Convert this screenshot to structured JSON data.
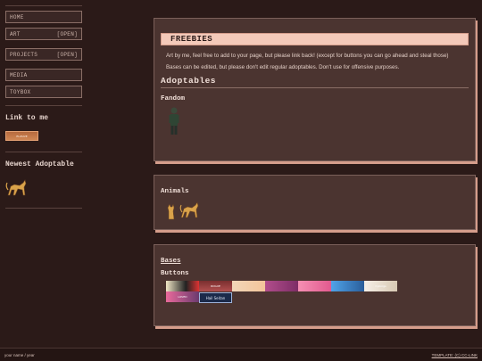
{
  "nav": {
    "items": [
      {
        "label": "HOME",
        "status": ""
      },
      {
        "label": "ART",
        "status": "[OPEN]"
      },
      {
        "label": "PROJECTS",
        "status": "[OPEN]"
      },
      {
        "label": "MEDIA",
        "status": ""
      },
      {
        "label": "TOYBOX",
        "status": ""
      }
    ]
  },
  "sidebar": {
    "link_heading": "Link to me",
    "link_button_text": "ELUSIVE",
    "newest_heading": "Newest Adoptable"
  },
  "freebies": {
    "title": "FREEBIES",
    "para1": "Art by me, feel free to add to your page, but please link back! (except for buttons you can go ahead and steal those)",
    "para2": "Bases can be edited, but please don't edit regular adoptables. Don't use for offensive purposes.",
    "adoptables_heading": "Adoptables",
    "fandom_heading": "Fandom"
  },
  "animals": {
    "heading": "Animals"
  },
  "bases": {
    "heading": "Bases",
    "buttons_heading": "Buttons",
    "hail_button_text": "Hail Seitan",
    "button_texts": [
      "",
      "ROGUE",
      "",
      "",
      "",
      "",
      "",
      "",
      "Cyborgs",
      "I'M",
      "",
      "LOVED"
    ]
  },
  "footer": {
    "left": "your name / year",
    "right": "TEMPLATE: (C) CC-LINK"
  },
  "colors": {
    "background": "#2b1a18",
    "panel": "#4b3430",
    "accent": "#f3c9b9",
    "shadow": "#d59d8b"
  }
}
